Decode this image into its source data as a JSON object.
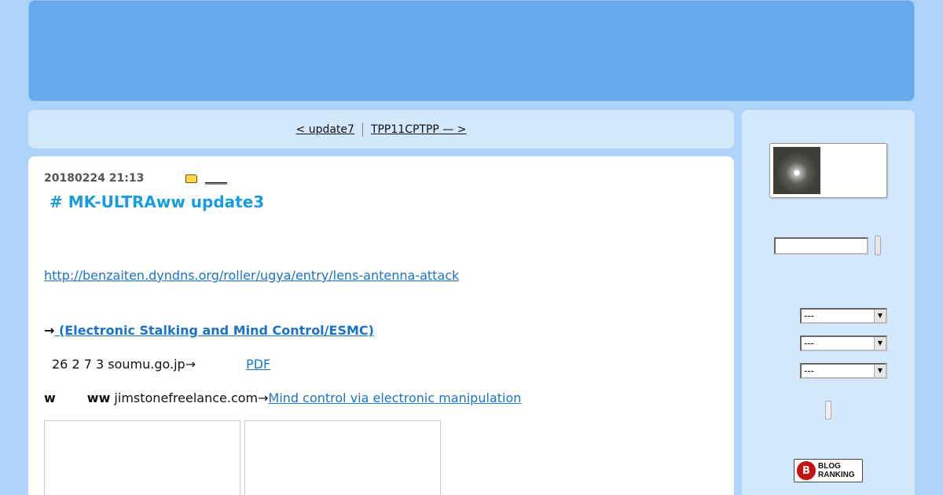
{
  "nav": {
    "prev_label": "<  update7",
    "next_label": "TPP11CPTPP — >"
  },
  "entry": {
    "datetime": "20180224 21:13",
    "category_icon": "folder-icon",
    "title": " # MK-ULTRAww update3",
    "link1": "http://benzaiten.dyndns.org/roller/ugya/entry/lens-antenna-attack",
    "arrow": "→",
    "esmc_link": " (Electronic Stalking and Mind Control/ESMC)",
    "line3_text": "26   2 7  3  soumu.go.jp→",
    "pdf_link": "PDF",
    "line4_w": "w",
    "line4_ww": "ww",
    "line4_text": "  jimstonefreelance.com→",
    "mind_control_link": "Mind control via electronic manipulation"
  },
  "sidebar": {
    "select1": "---",
    "select2": "---",
    "select3": "---",
    "ranking_line1": "BLOG",
    "ranking_line2": "RANKING"
  },
  "colors": {
    "background": "#aed4fb",
    "header": "#67aaec",
    "panel": "#d3e7fd",
    "title": "#1a9ce0",
    "link": "#1a73c9"
  }
}
